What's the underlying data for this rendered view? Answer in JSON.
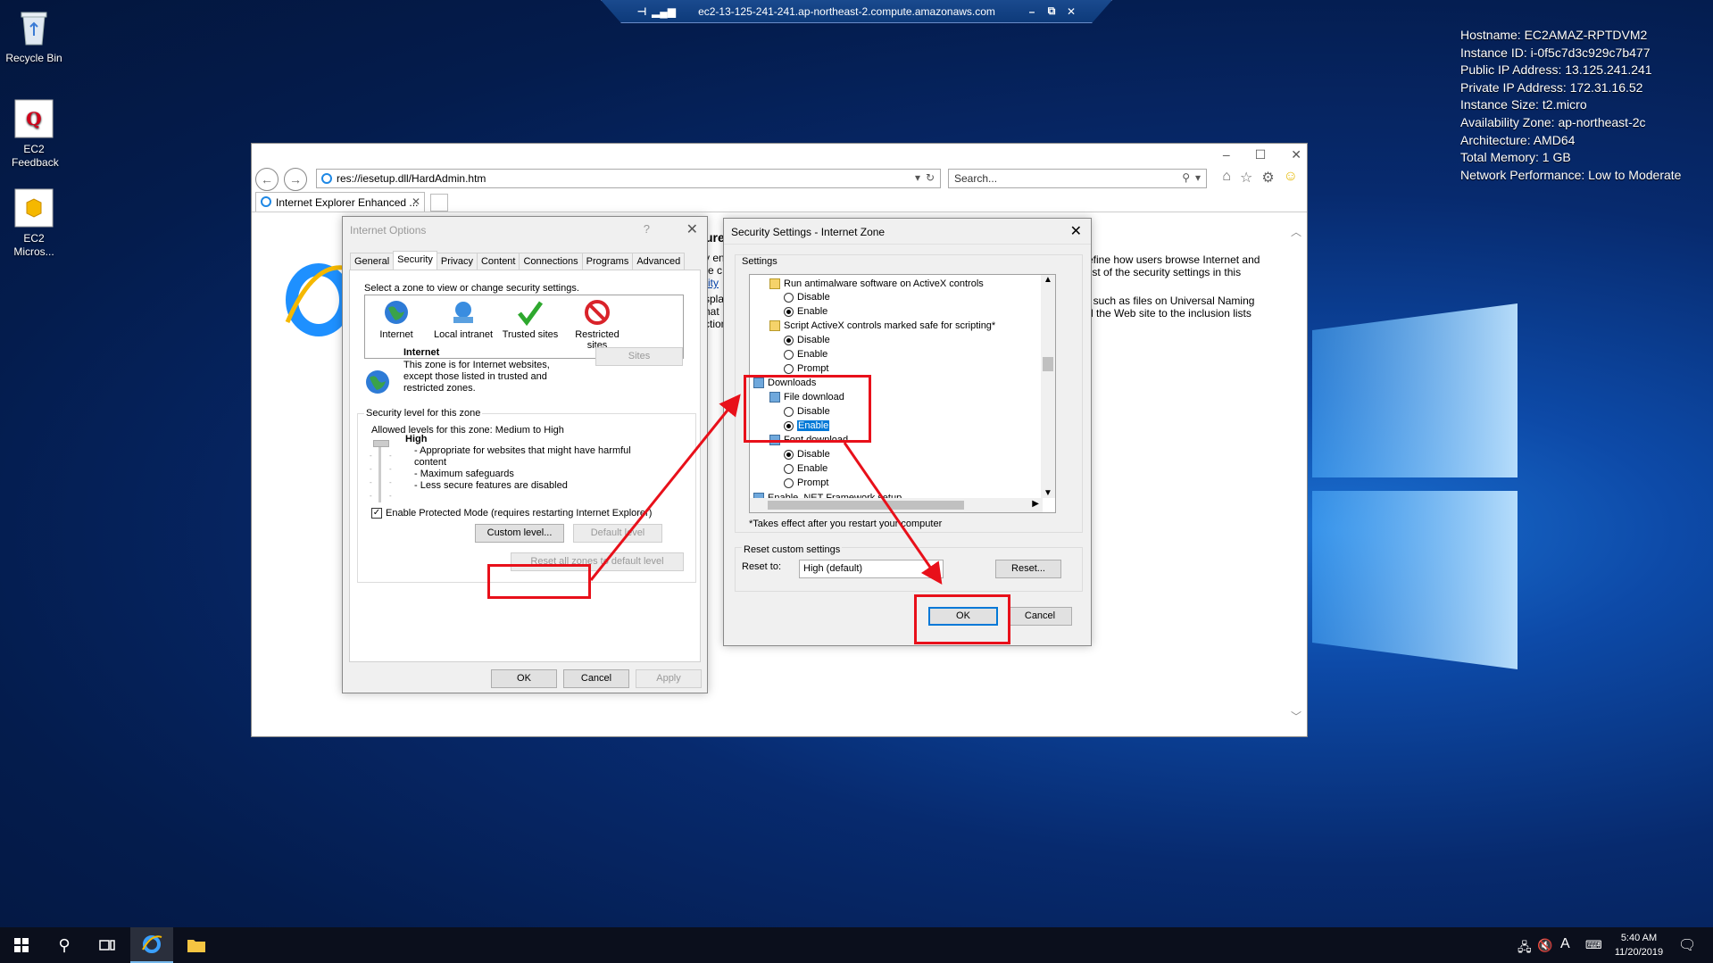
{
  "desktop": {
    "icons": [
      {
        "label": "Recycle Bin"
      },
      {
        "label": "EC2 Feedback"
      },
      {
        "label": "EC2 Micros..."
      }
    ],
    "sysinfo": [
      "Hostname: EC2AMAZ-RPTDVM2",
      "Instance ID: i-0f5c7d3c929c7b477",
      "Public IP Address: 13.125.241.241",
      "Private IP Address: 172.31.16.52",
      "Instance Size: t2.micro",
      "Availability Zone: ap-northeast-2c",
      "Architecture: AMD64",
      "Total Memory: 1 GB",
      "Network Performance: Low to Moderate"
    ]
  },
  "rdp": {
    "title": "ec2-13-125-241-241.ap-northeast-2.compute.amazonaws.com",
    "minimize": "–",
    "restore": "⧉",
    "close": "✕"
  },
  "ie": {
    "address": "res://iesetup.dll/HardAdmin.htm",
    "search_placeholder": "Search...",
    "tab_title": "Internet Explorer Enhanced ...",
    "page_lines_1": [
      "efine how users browse Internet and",
      "list of the security settings in this"
    ],
    "page_lines_2": [
      ", such as files on Universal Naming",
      "d the Web site to the inclusion lists"
    ],
    "page_left_fragments": [
      "ure",
      "y en",
      "re c",
      "rity",
      "spla",
      "hat",
      "ction"
    ]
  },
  "internet_options": {
    "title": "Internet Options",
    "help": "?",
    "tabs": [
      "General",
      "Security",
      "Privacy",
      "Content",
      "Connections",
      "Programs",
      "Advanced"
    ],
    "zone_prompt": "Select a zone to view or change security settings.",
    "zones": [
      "Internet",
      "Local intranet",
      "Trusted sites",
      "Restricted sites"
    ],
    "zone_name": "Internet",
    "zone_desc": [
      "This zone is for Internet websites,",
      "except those listed in trusted and",
      "restricted zones."
    ],
    "sites_btn": "Sites",
    "level_group": "Security level for this zone",
    "allowed": "Allowed levels for this zone: Medium to High",
    "level": "High",
    "level_points": [
      "- Appropriate for websites that might have harmful",
      "content",
      "- Maximum safeguards",
      "- Less secure features are disabled"
    ],
    "protected_mode": "Enable Protected Mode (requires restarting Internet Explorer)",
    "custom_level": "Custom level...",
    "default_level": "Default level",
    "reset_all": "Reset all zones to default level",
    "ok": "OK",
    "cancel": "Cancel",
    "apply": "Apply"
  },
  "security_settings": {
    "title": "Security Settings - Internet Zone",
    "settings_label": "Settings",
    "rows": [
      {
        "text": "Run antimalware software on ActiveX controls",
        "kind": "heading"
      },
      {
        "text": "Disable",
        "kind": "radio",
        "on": false
      },
      {
        "text": "Enable",
        "kind": "radio",
        "on": true
      },
      {
        "text": "Script ActiveX controls marked safe for scripting*",
        "kind": "heading"
      },
      {
        "text": "Disable",
        "kind": "radio",
        "on": true
      },
      {
        "text": "Enable",
        "kind": "radio",
        "on": false
      },
      {
        "text": "Prompt",
        "kind": "radio",
        "on": false
      },
      {
        "text": "Downloads",
        "kind": "group"
      },
      {
        "text": "File download",
        "kind": "heading2"
      },
      {
        "text": "Disable",
        "kind": "radio",
        "on": false
      },
      {
        "text": "Enable",
        "kind": "radio",
        "on": true,
        "selected": true
      },
      {
        "text": "Font download",
        "kind": "heading2"
      },
      {
        "text": "Disable",
        "kind": "radio",
        "on": true
      },
      {
        "text": "Enable",
        "kind": "radio",
        "on": false
      },
      {
        "text": "Prompt",
        "kind": "radio",
        "on": false
      },
      {
        "text": "Enable .NET Framework setup",
        "kind": "heading"
      }
    ],
    "note": "*Takes effect after you restart your computer",
    "reset_group": "Reset custom settings",
    "reset_to": "Reset to:",
    "reset_value": "High (default)",
    "reset_btn": "Reset...",
    "ok": "OK",
    "cancel": "Cancel"
  },
  "taskbar": {
    "time": "5:40 AM",
    "date": "11/20/2019",
    "ime": "A"
  }
}
